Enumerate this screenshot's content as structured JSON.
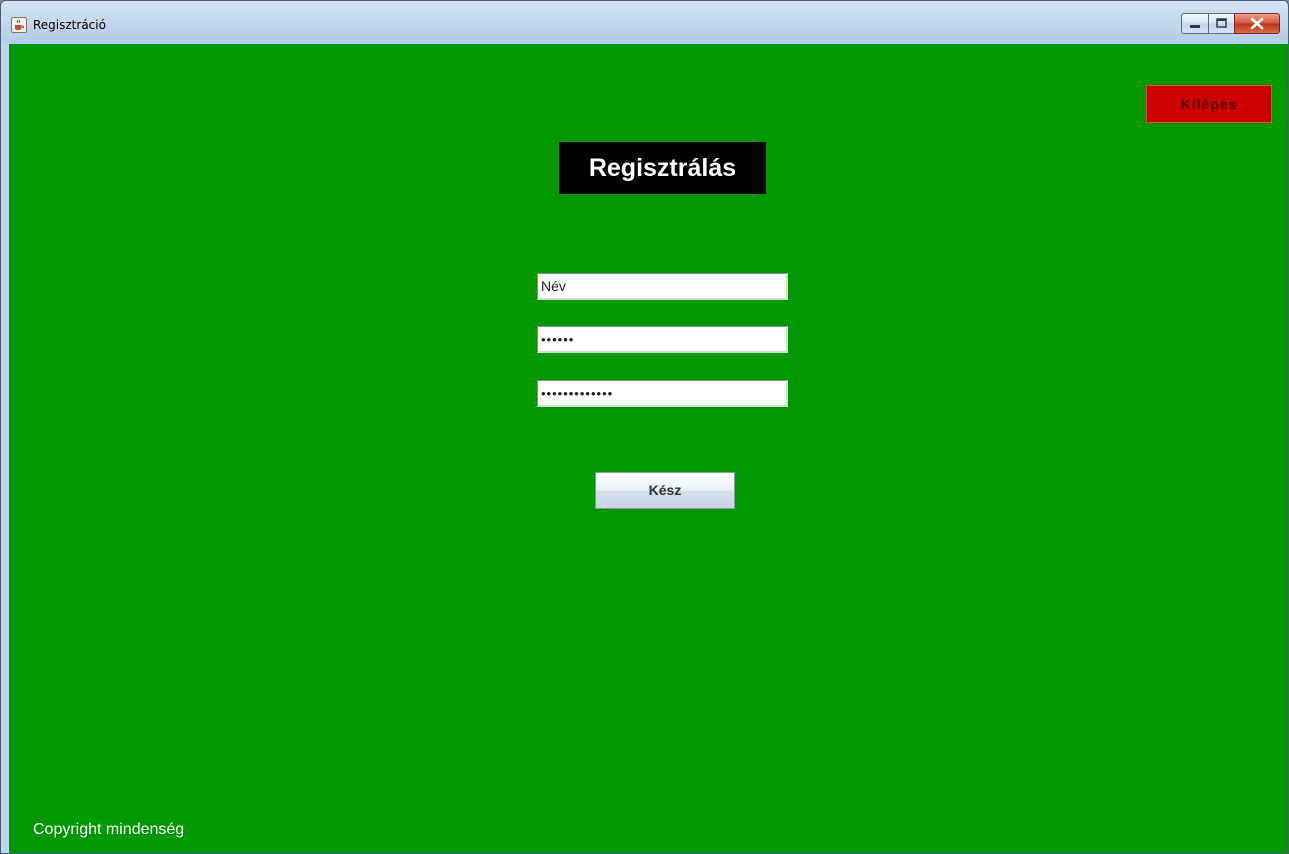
{
  "window": {
    "title": "Regisztráció",
    "controls": {
      "minimize_icon": "minimize-icon",
      "maximize_icon": "maximize-icon",
      "close_icon": "close-icon"
    },
    "app_icon": "java-cup-icon"
  },
  "colors": {
    "background": "#009800",
    "title_bg": "#000000",
    "title_text": "#ffffff",
    "exit_bg": "#cc0000",
    "exit_text": "#5a0000"
  },
  "header": {
    "exit_label": "Kilépés",
    "page_title": "Regisztrálás"
  },
  "form": {
    "name_value": "Név",
    "password_value": "••••••",
    "password_confirm_value": "•••••••••••••",
    "submit_label": "Kész"
  },
  "footer": {
    "copyright": "Copyright mindenség"
  }
}
